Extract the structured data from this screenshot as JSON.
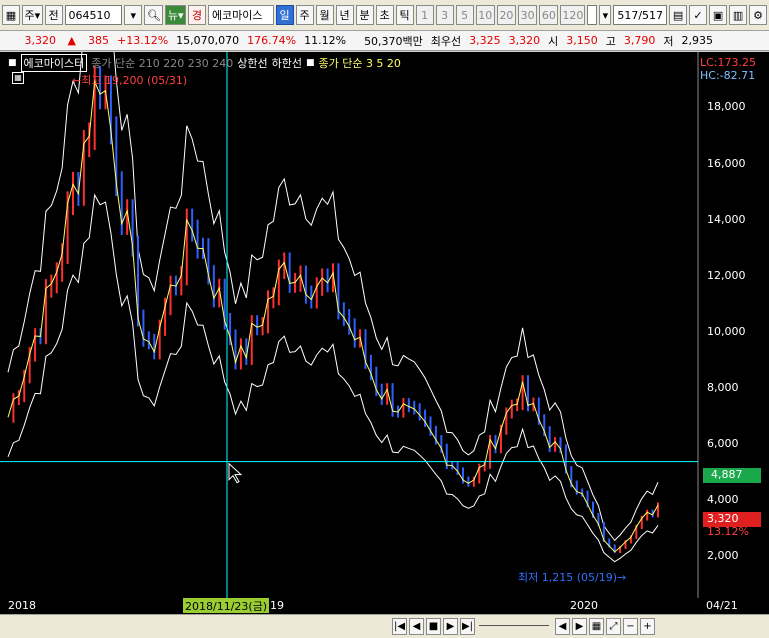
{
  "toolbar": {
    "mode_a": "주",
    "mode_b": "전",
    "code": "064510",
    "news_label": "뉴",
    "badge": "경",
    "stock_name": "에코마이스",
    "periods": [
      "일",
      "주",
      "월",
      "년"
    ],
    "minute_labels": [
      "분",
      "초",
      "틱"
    ],
    "intervals": [
      "1",
      "3",
      "5",
      "10",
      "20",
      "30",
      "60",
      "120"
    ],
    "range_value": "517",
    "range_total": "/517"
  },
  "pricebar": {
    "price": "3,320",
    "change_arrow": "▲",
    "change": "385",
    "change_pct": "+13.12%",
    "volume": "15,070,070",
    "volume_ratio": "176.74%",
    "turnover": "11.12%",
    "amount": "50,370백만",
    "best_label": "최우선",
    "best_ask": "3,325",
    "best_bid": "3,320",
    "open_label": "시",
    "open": "3,150",
    "high_label": "고",
    "high": "3,790",
    "low_label": "저",
    "low": "2,935"
  },
  "chart": {
    "legend_name": "에코마이스터",
    "legend_hidden": "종가 단순 210 220 230 240",
    "legend_upper": "상한선",
    "legend_lower": "하한선",
    "legend_ma": "종가 단순 3 5 20",
    "high_marker": "←최고 19,200 (05/31)",
    "low_marker": "최저 1,215 (05/19)→",
    "lc": "LC:173.25",
    "hc": "HC:-82.71",
    "crosshair_value": "4,887",
    "current_value": "3,320",
    "current_pct": "13.12%",
    "yticks": [
      "18,000",
      "16,000",
      "14,000",
      "12,000",
      "10,000",
      "8,000",
      "6,000",
      "4,000",
      "2,000"
    ],
    "colors": {
      "background": "#000000",
      "up": "#ff3030",
      "down": "#3060ff",
      "crosshair": "#00ffff",
      "band": "#ffffff"
    }
  },
  "dateaxis": {
    "label_2018": "2018",
    "crosshair_date": "2018/11/23(금)",
    "label_19": "19",
    "label_2020": "2020",
    "last_date": "04/21"
  },
  "chart_data": {
    "type": "line",
    "title": "",
    "xlabel": "",
    "ylabel": "",
    "ylim": [
      0,
      19500
    ],
    "x": [
      "2018/01",
      "2018/03",
      "2018/05",
      "2018/07",
      "2018/09",
      "2018/11",
      "2019/01",
      "2019/03",
      "2019/05",
      "2019/07",
      "2019/09",
      "2019/11",
      "2020/01",
      "2020/03",
      "2020/04"
    ],
    "series": [
      {
        "values": [
          6500,
          11500,
          19200,
          8500,
          13500,
          8500,
          12000,
          11000,
          7500,
          6000,
          4000,
          7500,
          4800,
          1600,
          3320
        ]
      }
    ]
  }
}
